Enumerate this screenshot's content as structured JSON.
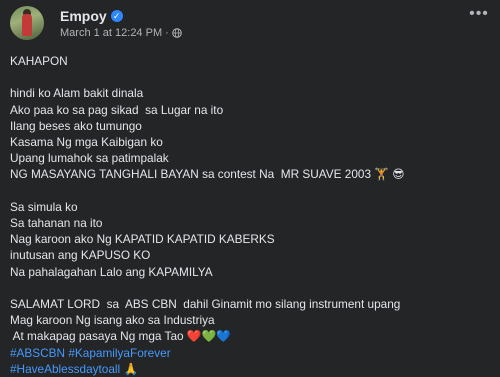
{
  "author": {
    "name": "Empoy",
    "timestamp": "March 1 at 12:24 PM",
    "separator": "·"
  },
  "post": {
    "heading": "KAHAPON",
    "stanza1": [
      "hindi ko Alam bakit dinala",
      "Ako paa ko sa pag sikad  sa Lugar na ito",
      "Ilang beses ako tumungo",
      "Kasama Ng mga Kaibigan ko",
      "Upang lumahok sa patimpalak",
      "NG MASAYANG TANGHALI BAYAN sa contest Na  MR SUAVE 2003 🏋 😎"
    ],
    "stanza2": [
      "Sa simula ko",
      "Sa tahanan na ito",
      "Nag karoon ako Ng KAPATID KAPATID KABERKS",
      "inutusan ang KAPUSO KO",
      "Na pahalagahan Lalo ang KAPAMILYA"
    ],
    "stanza3": [
      "SALAMAT LORD  sa  ABS CBN  dahil Ginamit mo silang instrument upang",
      "Mag karoon Ng isang ako sa Industriya",
      " At makapag pasaya Ng mga Tao ❤️💚💙"
    ],
    "hashtags": [
      "#ABSCBN #KapamilyaForever",
      "#HaveAblessdaytoall 🙏"
    ]
  },
  "icons": {
    "verified": "verified-badge-icon",
    "globe": "globe-icon",
    "more": "more-options-icon"
  },
  "colors": {
    "background": "#242526",
    "text": "#e4e6eb",
    "secondary": "#b0b3b8",
    "link": "#4599ff",
    "verified": "#2d88ff"
  }
}
